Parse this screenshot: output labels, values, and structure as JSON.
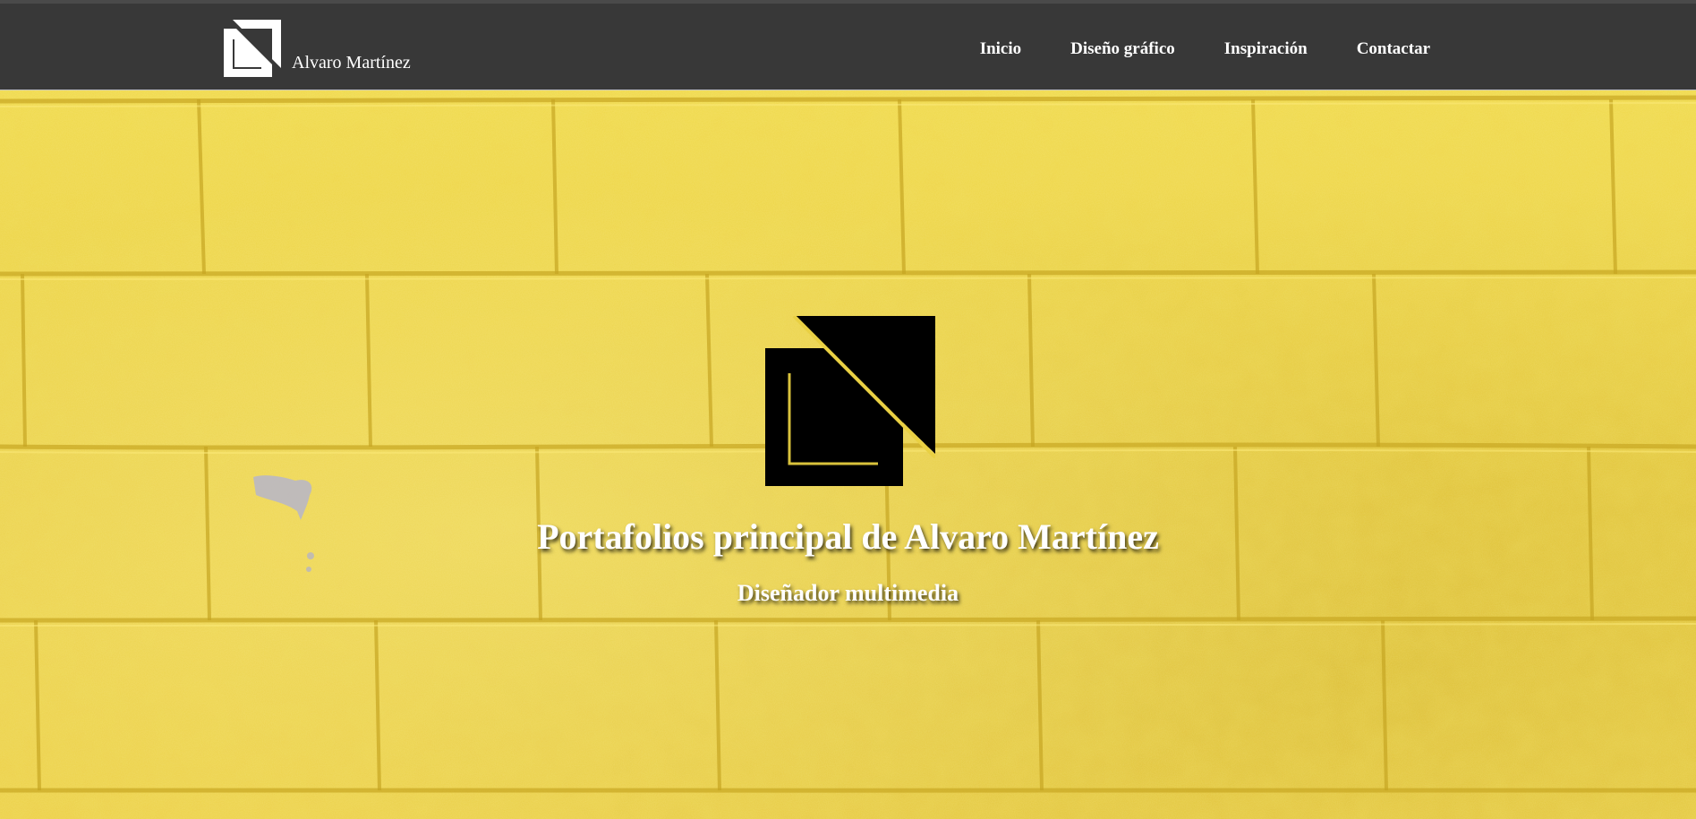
{
  "header": {
    "brand_name": "Alvaro Martínez",
    "logo_icon": "square-triangle-logo-icon",
    "nav": [
      {
        "label": "Inicio"
      },
      {
        "label": "Diseño gráfico"
      },
      {
        "label": "Inspiración"
      },
      {
        "label": "Contactar"
      }
    ]
  },
  "hero": {
    "logo_icon": "square-triangle-logo-icon",
    "title": "Portafolios principal de Alvaro Martínez",
    "subtitle": "Diseñador multimedia",
    "background": "yellow-brick-wall"
  },
  "colors": {
    "navbar_bg": "#383838",
    "nav_text": "#ffffff",
    "hero_yellow": "#e9d043",
    "logo_black": "#000000"
  }
}
